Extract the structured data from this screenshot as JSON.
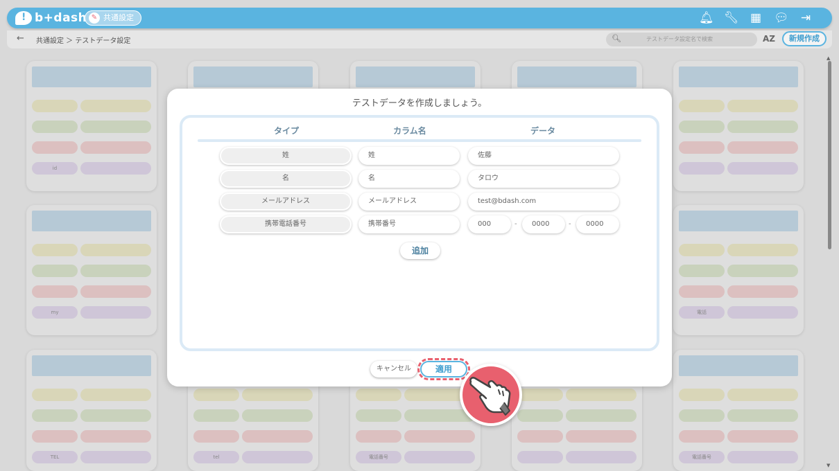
{
  "header": {
    "logo_text": "b+dash",
    "section_badge": "共通設定",
    "icons": [
      "bell-icon",
      "wrench-icon",
      "grid-icon",
      "chat-icon",
      "logout-icon"
    ]
  },
  "subheader": {
    "breadcrumb": "共通設定 ＞ テストデータ設定",
    "search_placeholder": "テストデータ設定名で検索",
    "sort_label": "AZ",
    "new_button": "新規作成"
  },
  "background_cards": [
    {
      "id_label": "id"
    },
    {},
    {},
    {},
    {},
    {
      "id_label": "my"
    },
    {},
    {},
    {},
    {
      "id_label": "電話"
    },
    {
      "id_label": "TEL"
    },
    {
      "id_label": "tel"
    },
    {
      "id_label": "電話番号"
    },
    {},
    {
      "id_label": "電話番号"
    }
  ],
  "modal": {
    "title": "テストデータを作成しましょう。",
    "columns": {
      "type": "タイプ",
      "column_name": "カラム名",
      "data": "データ"
    },
    "rows": [
      {
        "type": "姓",
        "column": "姓",
        "data": "佐藤"
      },
      {
        "type": "名",
        "column": "名",
        "data": "タロウ"
      },
      {
        "type": "メールアドレス",
        "column": "メールアドレス",
        "data": "test@bdash.com"
      },
      {
        "type": "携帯電話番号",
        "column": "携帯番号",
        "phone": [
          "000",
          "0000",
          "0000"
        ],
        "separator": "-"
      }
    ],
    "add_button": "追加",
    "cancel_button": "キャンセル",
    "apply_button": "適用"
  },
  "colors": {
    "brand": "#5ab4e0",
    "highlight": "#e8606e"
  }
}
